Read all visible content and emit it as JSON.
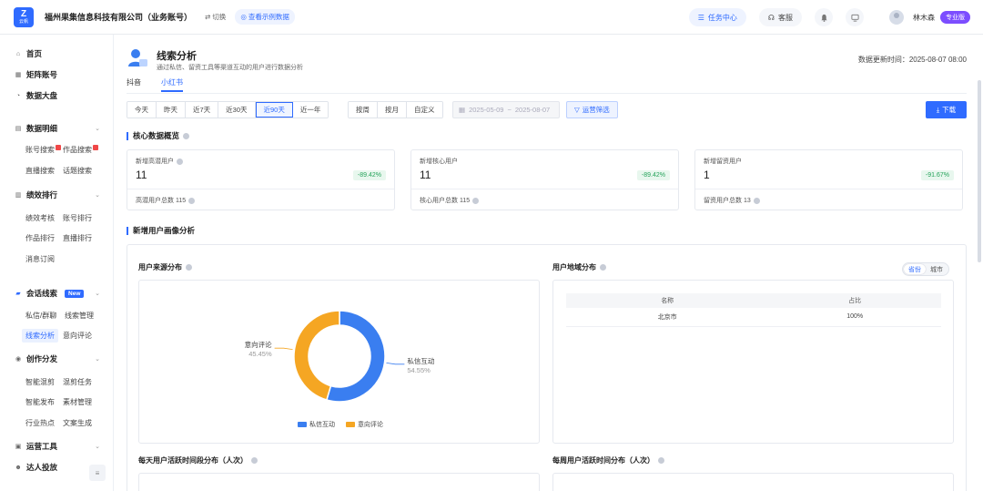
{
  "topbar": {
    "logo_mark": "Z",
    "logo_sub": "云帆",
    "company": "福州果集信息科技有限公司（业务账号）",
    "switch_label": "切换",
    "demo_label": "查看示例数据",
    "task_center": "任务中心",
    "support": "客服",
    "username": "林木森",
    "plan": "专业版"
  },
  "sidebar": {
    "home": "首页",
    "matrix": "矩阵账号",
    "dashboard": "数据大盘",
    "data_detail": "数据明细",
    "account_search": "账号搜索",
    "works_search": "作品搜索",
    "live_search": "直播搜索",
    "topic_search": "话题搜索",
    "performance": "绩效排行",
    "perf_assess": "绩效考核",
    "account_rank": "账号排行",
    "works_rank": "作品排行",
    "live_rank": "直播排行",
    "msg_sub": "消息订阅",
    "conversation": "会话线索",
    "new_badge": "New",
    "private_group": "私信/群聊",
    "lead_manage": "线索管理",
    "lead_analysis": "线索分析",
    "intent_comment": "意向评论",
    "create_dist": "创作分发",
    "smart_mix": "智能混剪",
    "mix_task": "混剪任务",
    "smart_publish": "智能发布",
    "material": "素材管理",
    "trending": "行业热点",
    "copy_gen": "文案生成",
    "ops_tools": "运营工具",
    "talent": "达人投放"
  },
  "page": {
    "title": "线索分析",
    "desc": "通过私信、留资工具等渠道互动的用户进行数据分析",
    "update_time": "数据更新时间：2025-08-07 08:00",
    "tabs": [
      "抖音",
      "小红书"
    ],
    "date_quick": [
      "今天",
      "昨天",
      "近7天",
      "近30天",
      "近90天",
      "近一年"
    ],
    "period": [
      "按周",
      "按月",
      "自定义"
    ],
    "date_start": "2025-05-09",
    "date_sep": "~",
    "date_end": "2025-08-07",
    "op_filter": "运营筛选",
    "download": "下载"
  },
  "core": {
    "title": "核心数据概览",
    "cards": [
      {
        "label": "新增高潜用户",
        "value": "11",
        "change": "-89.42%",
        "footer": "高潜用户总数 115"
      },
      {
        "label": "新增核心用户",
        "value": "11",
        "change": "-89.42%",
        "footer": "核心用户总数 115"
      },
      {
        "label": "新增留资用户",
        "value": "1",
        "change": "-91.67%",
        "footer": "留资用户总数 13"
      }
    ]
  },
  "profile": {
    "title": "新增用户画像分析",
    "source_title": "用户来源分布",
    "region_title": "用户地域分布",
    "region_toggle": [
      "省份",
      "城市"
    ],
    "region_headers": [
      "名称",
      "占比"
    ],
    "region_rows": [
      [
        "北京市",
        "100%"
      ]
    ],
    "daily_title": "每天用户活跃时间段分布（人次）",
    "weekly_title": "每周用户活跃时间分布（人次）"
  },
  "chart_data": {
    "type": "pie",
    "categories": [
      "私信互动",
      "意向评论"
    ],
    "values": [
      54.55,
      45.45
    ],
    "labels": [
      "54.55%",
      "45.45%"
    ],
    "colors": [
      "#3a7ef0",
      "#f5a623"
    ],
    "legend": "bottom"
  }
}
